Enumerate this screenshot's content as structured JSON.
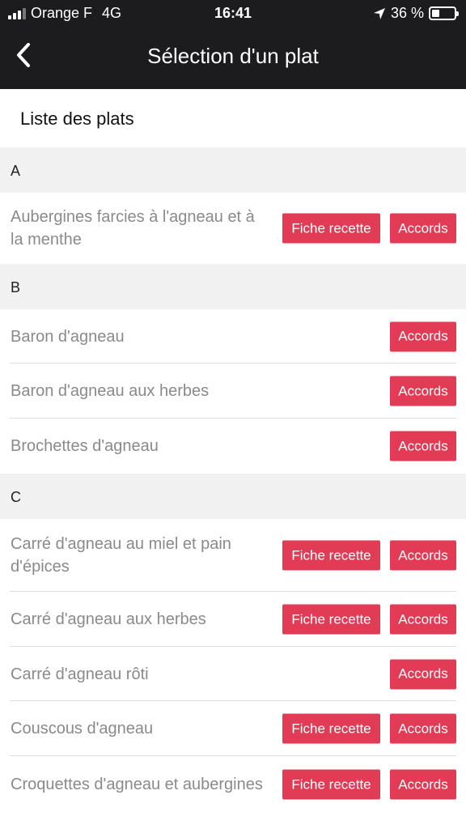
{
  "status_bar": {
    "carrier": "Orange F",
    "network": "4G",
    "time": "16:41",
    "battery": "36 %",
    "battery_level": 0.36,
    "icons": [
      "signal-icon",
      "location-arrow-icon",
      "battery-icon"
    ]
  },
  "nav": {
    "title": "Sélection d'un plat",
    "back_icon": "chevron-left-icon"
  },
  "list_title": "Liste des plats",
  "colors": {
    "topbar": "#1c1c1e",
    "button": "#e23b55",
    "section_bg": "#f1f1f1",
    "item_text": "#8a8a8a"
  },
  "buttons": {
    "recipe": "Fiche recette",
    "accords": "Accords"
  },
  "sections": [
    {
      "letter": "A",
      "items": [
        {
          "name": "Aubergines farcies à l'agneau et à la menthe",
          "has_recipe": true
        }
      ]
    },
    {
      "letter": "B",
      "items": [
        {
          "name": "Baron d'agneau",
          "has_recipe": false
        },
        {
          "name": "Baron d'agneau aux herbes",
          "has_recipe": false
        },
        {
          "name": "Brochettes d'agneau",
          "has_recipe": false
        }
      ]
    },
    {
      "letter": "C",
      "items": [
        {
          "name": "Carré d'agneau au miel et pain d'épices",
          "has_recipe": true
        },
        {
          "name": "Carré d'agneau aux herbes",
          "has_recipe": true
        },
        {
          "name": "Carré d'agneau rôti",
          "has_recipe": false
        },
        {
          "name": "Couscous d'agneau",
          "has_recipe": true
        },
        {
          "name": "Croquettes d'agneau et aubergines",
          "has_recipe": true
        }
      ]
    }
  ]
}
